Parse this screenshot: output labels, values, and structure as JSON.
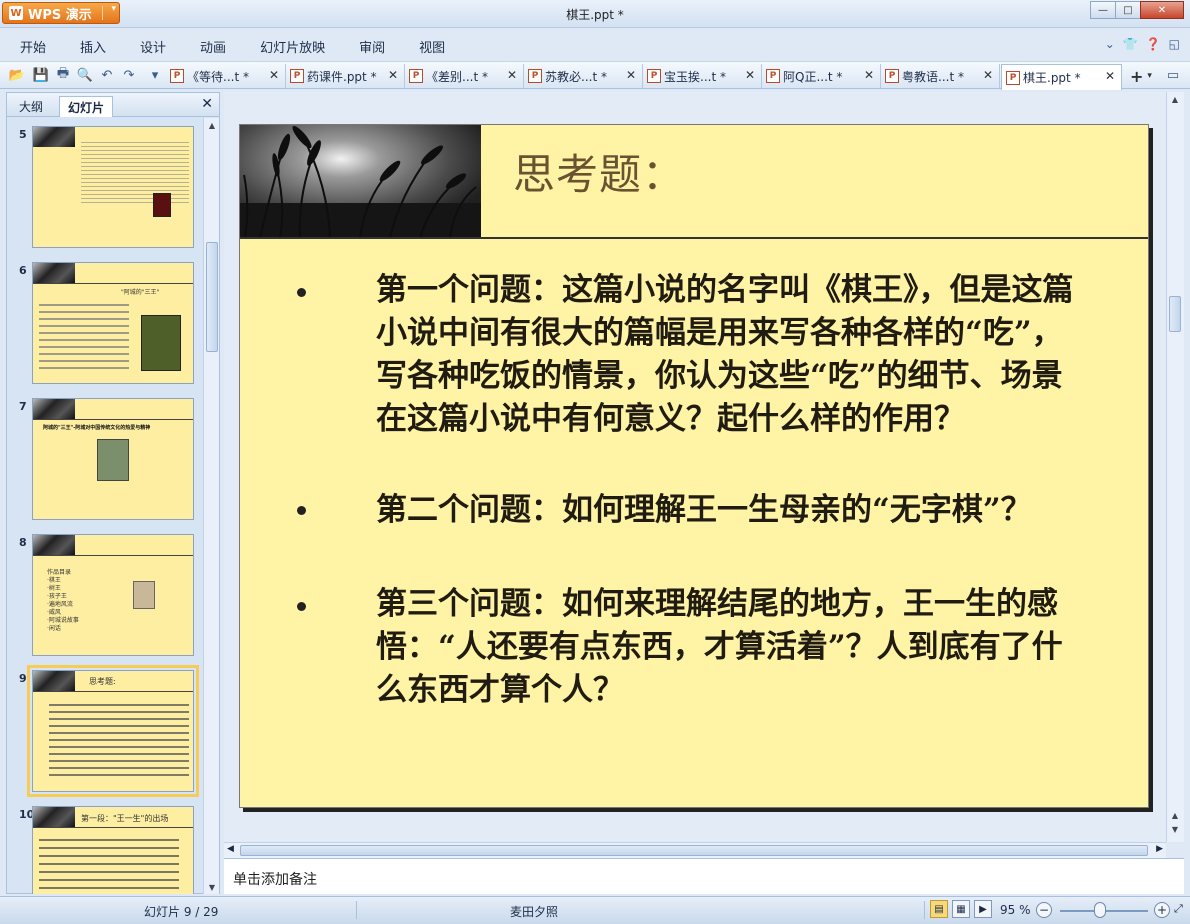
{
  "app": {
    "brand": "WPS 演示",
    "window_title": "棋王.ppt *"
  },
  "menu": [
    "开始",
    "插入",
    "设计",
    "动画",
    "幻灯片放映",
    "审阅",
    "视图"
  ],
  "tabs": [
    {
      "label": "《等待...t *"
    },
    {
      "label": "药课件.ppt *"
    },
    {
      "label": "《差别...t *"
    },
    {
      "label": "苏教必...t *"
    },
    {
      "label": "宝玉挨...t *"
    },
    {
      "label": "阿Q正...t *"
    },
    {
      "label": "粤教语...t *"
    },
    {
      "label": "棋王.ppt *"
    }
  ],
  "panel": {
    "tabs": [
      "大纲",
      "幻灯片"
    ],
    "active_tab": "幻灯片"
  },
  "thumbnails": [
    {
      "num": "5"
    },
    {
      "num": "6",
      "title": "\"阿城的\"三王\""
    },
    {
      "num": "7",
      "text": "阿城的\"三王\"-阿城对中国传统文化的热爱与精神"
    },
    {
      "num": "8",
      "lines": [
        "作品目录",
        "·棋王",
        "·树王",
        "·孩子王",
        "·遍地风流",
        "·威风",
        "·阿城说故事",
        "·闲话"
      ]
    },
    {
      "num": "9",
      "title": "思考题:",
      "selected": true
    },
    {
      "num": "10",
      "title": "第一段：\"王一生\"的出场"
    }
  ],
  "slide": {
    "title": "思考题：",
    "bullets": [
      "第一个问题：这篇小说的名字叫《棋王》，但是这篇小说中间有很大的篇幅是用来写各种各样的“吃”，写各种吃饭的情景，你认为这些“吃”的细节、场景在这篇小说中有何意义？起什么样的作用？",
      "第二个问题：如何理解王一生母亲的“无字棋”？",
      "第三个问题：如何来理解结尾的地方，王一生的感悟：“人还要有点东西，才算活着”？人到底有了什么东西才算个人？"
    ]
  },
  "notes": {
    "placeholder": "单击添加备注"
  },
  "status": {
    "slide_counter": "幻灯片 9 / 29",
    "theme": "麦田夕照",
    "zoom": "95 %",
    "zoom_fraction": 0.5
  },
  "colors": {
    "slide_bg": "#fff3a6",
    "accent": "#e4741b",
    "title_text": "#6a5230"
  }
}
